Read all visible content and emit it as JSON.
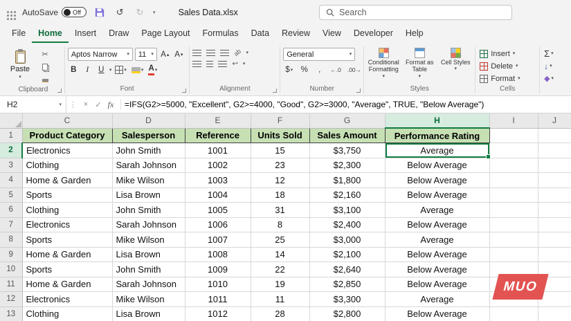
{
  "titlebar": {
    "autosave_label": "AutoSave",
    "autosave_state": "Off",
    "title": "Sales Data.xlsx",
    "search_placeholder": "Search"
  },
  "menubar": {
    "tabs": [
      "File",
      "Home",
      "Insert",
      "Draw",
      "Page Layout",
      "Formulas",
      "Data",
      "Review",
      "View",
      "Developer",
      "Help"
    ],
    "active_tab": "Home"
  },
  "ribbon": {
    "clipboard": {
      "label": "Clipboard",
      "paste_label": "Paste"
    },
    "font": {
      "label": "Font",
      "font_name": "Aptos Narrow",
      "font_size": "11",
      "bold": "B",
      "italic": "I",
      "underline": "U"
    },
    "alignment": {
      "label": "Alignment"
    },
    "number": {
      "label": "Number",
      "format": "General",
      "currency": "$",
      "percent": "%",
      "comma": ",",
      "increase_decimal": "←.0",
      "decrease_decimal": ".00→"
    },
    "styles": {
      "label": "Styles",
      "conditional": "Conditional Formatting",
      "format_table": "Format as Table",
      "cell_styles": "Cell Styles"
    },
    "cells": {
      "label": "Cells",
      "insert": "Insert",
      "delete": "Delete",
      "format": "Format"
    },
    "editing": {
      "autosum": "Σ"
    }
  },
  "formula_bar": {
    "name_box": "H2",
    "cancel": "×",
    "enter": "✓",
    "insert_function": "fx",
    "formula": "=IFS(G2>=5000, \"Excellent\", G2>=4000, \"Good\", G2>=3000, \"Average\", TRUE, \"Below Average\")"
  },
  "sheet": {
    "columns": [
      "C",
      "D",
      "E",
      "F",
      "G",
      "H",
      "I",
      "J"
    ],
    "selected_cell": "H2",
    "header_row": [
      "Product Category",
      "Salesperson",
      "Reference",
      "Units Sold",
      "Sales Amount",
      "Performance Rating"
    ],
    "rows": [
      {
        "n": 2,
        "cells": [
          "Electronics",
          "John Smith",
          "1001",
          "15",
          "$3,750",
          "Average"
        ]
      },
      {
        "n": 3,
        "cells": [
          "Clothing",
          "Sarah Johnson",
          "1002",
          "23",
          "$2,300",
          "Below Average"
        ]
      },
      {
        "n": 4,
        "cells": [
          "Home & Garden",
          "Mike Wilson",
          "1003",
          "12",
          "$1,800",
          "Below Average"
        ]
      },
      {
        "n": 5,
        "cells": [
          "Sports",
          "Lisa Brown",
          "1004",
          "18",
          "$2,160",
          "Below Average"
        ]
      },
      {
        "n": 6,
        "cells": [
          "Clothing",
          "John Smith",
          "1005",
          "31",
          "$3,100",
          "Average"
        ]
      },
      {
        "n": 7,
        "cells": [
          "Electronics",
          "Sarah Johnson",
          "1006",
          "8",
          "$2,400",
          "Below Average"
        ]
      },
      {
        "n": 8,
        "cells": [
          "Sports",
          "Mike Wilson",
          "1007",
          "25",
          "$3,000",
          "Average"
        ]
      },
      {
        "n": 9,
        "cells": [
          "Home & Garden",
          "Lisa Brown",
          "1008",
          "14",
          "$2,100",
          "Below Average"
        ]
      },
      {
        "n": 10,
        "cells": [
          "Sports",
          "John Smith",
          "1009",
          "22",
          "$2,640",
          "Below Average"
        ]
      },
      {
        "n": 11,
        "cells": [
          "Home & Garden",
          "Sarah Johnson",
          "1010",
          "19",
          "$2,850",
          "Below Average"
        ]
      },
      {
        "n": 12,
        "cells": [
          "Electronics",
          "Mike Wilson",
          "1011",
          "11",
          "$3,300",
          "Average"
        ]
      },
      {
        "n": 13,
        "cells": [
          "Clothing",
          "Lisa Brown",
          "1012",
          "28",
          "$2,800",
          "Below Average"
        ]
      }
    ],
    "accent_green": "#107C41",
    "header_fill": "#C6E0B4"
  },
  "watermark": {
    "text": "MUO",
    "color": "#E25352"
  }
}
